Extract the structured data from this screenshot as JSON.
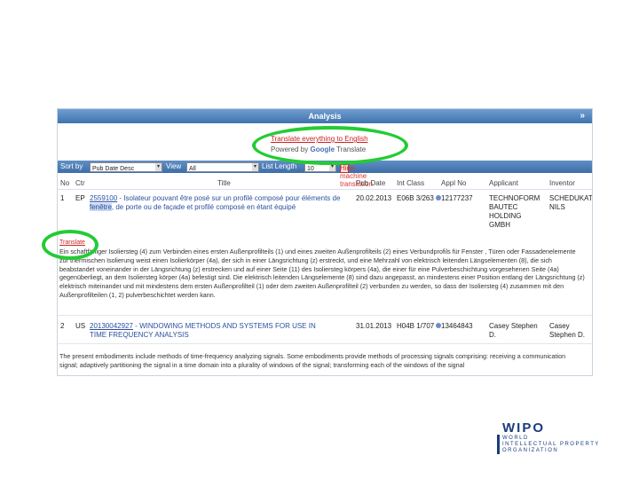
{
  "header": {
    "title": "Analysis",
    "collapse_glyph": "»"
  },
  "translate": {
    "link": "Translate everything to English",
    "powered_by": "Powered by",
    "google": "Google",
    "translate_word": "Translate"
  },
  "toolbar": {
    "sort_by_label": "Sort by",
    "sort_by_value": "Pub Date Desc",
    "view_label": "View",
    "view_value": "All",
    "list_length_label": "List Length",
    "list_length_value": "10",
    "hide_translation": "Hide machine translation"
  },
  "columns": [
    "No",
    "Ctr",
    "Title",
    "Pub Date",
    "Int Class",
    "Appl No",
    "Applicant",
    "Inventor"
  ],
  "rows": [
    {
      "no": "1",
      "ctr": "EP",
      "title_id": "2559100",
      "title_a": " - Isolateur pouvant être posé sur un profilé composé pour éléments de ",
      "title_hl": "fenêtre",
      "title_b": ", de porte ou de façade et profilé composé en étant équipé",
      "pub_date": "20.02.2013",
      "int_class": "E06B 3/263",
      "appl_no": "12177237",
      "applicant": "TECHNOFORM BAUTEC HOLDING GMBH",
      "inventor": "SCHEDUKAT NILS",
      "translate_label": "Translate",
      "description": "Ein schaftfähiger Isoliersteg (4) zum Verbinden eines ersten Außenprofilteils (1) und eines zweiten Außenprofilteils (2) eines Verbundprofils für Fenster , Türen oder Fassadenelemente zur thermischen Isolierung weist einen Isolierkörper (4a), der sich in einer Längsrichtung (z) erstreckt, und eine Mehrzahl von elektrisch leitenden Längselementen (8), die sich beabstandet voneinander in der Längsrichtung (z) erstrecken und auf einer Seite (11) des Isoliersteg körpers (4a), die einer für eine Pulverbeschichtung vorgesehenen Seite (4a) gegenüberliegt, an dem Isoliersteg körper (4a) befestigt sind. Die elektrisch leitenden Längselemente (8) sind dazu angepasst, an mindestens einer Position entlang der Längsrichtung (z) elektrisch miteinander und mit mindestens dem ersten Außenprofilteil (1) oder dem zweiten Außenprofilteil (2) verbunden zu werden, so dass der Isoliersteg (4) zusammen mit den Außenprofilteilen (1, 2) pulverbeschichtet werden kann."
    },
    {
      "no": "2",
      "ctr": "US",
      "title_id": "20130042927",
      "title_a": " - WINDOWING METHODS AND SYSTEMS FOR USE IN TIME FREQUENCY ANALYSIS",
      "title_hl": "",
      "title_b": "",
      "pub_date": "31.01.2013",
      "int_class": "H04B 1/707",
      "appl_no": "13464843",
      "applicant": "Casey Stephen D.",
      "inventor": "Casey Stephen D.",
      "translate_label": "",
      "description": "The present embodiments include methods of time-frequency analyzing signals. Some embodiments provide methods of processing signals comprising: receiving a communication signal; adaptively partitioning the signal in a time domain into a plurality of windows of the signal; transforming each of the windows of the signal"
    }
  ],
  "logo": {
    "name": "WIPO",
    "line1": "WORLD",
    "line2": "INTELLECTUAL PROPERTY",
    "line3": "ORGANIZATION"
  },
  "colors": {
    "accent": "#3f73ad",
    "highlight": "#22cc33",
    "link": "#2a4fa0"
  }
}
